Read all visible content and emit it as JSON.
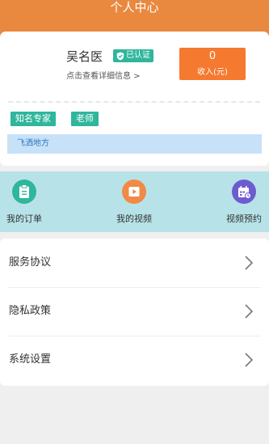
{
  "header": {
    "title": "个人中心",
    "color": "#e8893f"
  },
  "profile": {
    "name": "吴名医",
    "verified_label": "已认证",
    "detail_link": "点击查看详细信息 >",
    "income": {
      "value": "0",
      "label": "收入(元)"
    },
    "tags": [
      "知名专家",
      "老师"
    ],
    "location": "飞洒地方"
  },
  "shortcuts": [
    {
      "label": "我的订单",
      "icon": "clipboard-icon",
      "color": "#2fb69c"
    },
    {
      "label": "我的视频",
      "icon": "play-icon",
      "color": "#f08a46"
    },
    {
      "label": "视频预约",
      "icon": "calendar-icon",
      "color": "#6d5bd0"
    }
  ],
  "menu": {
    "items": [
      {
        "label": "服务协议",
        "icon": "chevron-right-icon"
      },
      {
        "label": "隐私政策",
        "icon": "chevron-right-icon"
      },
      {
        "label": "系统设置",
        "icon": "chevron-right-icon"
      }
    ]
  },
  "colors": {
    "accent_green": "#2fb69c",
    "income_orange": "#f5792f",
    "shortcut_bg": "#b7e3e8"
  }
}
